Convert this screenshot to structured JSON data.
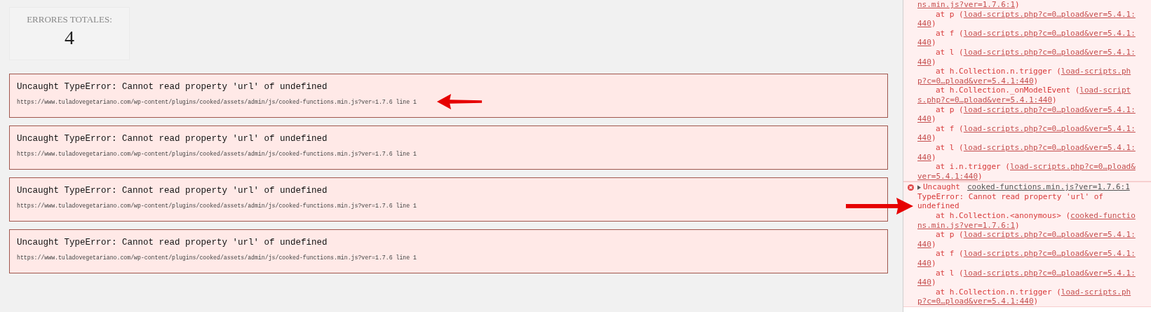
{
  "summary": {
    "label": "ERRORES TOTALES:",
    "count": "4"
  },
  "errors": [
    {
      "message": "Uncaught TypeError: Cannot read property 'url' of undefined",
      "source": "https://www.tuladovegetariano.com/wp-content/plugins/cooked/assets/admin/js/cooked-functions.min.js?ver=1.7.6 line 1",
      "highlighted": true
    },
    {
      "message": "Uncaught TypeError: Cannot read property 'url' of undefined",
      "source": "https://www.tuladovegetariano.com/wp-content/plugins/cooked/assets/admin/js/cooked-functions.min.js?ver=1.7.6 line 1",
      "highlighted": false
    },
    {
      "message": "Uncaught TypeError: Cannot read property 'url' of undefined",
      "source": "https://www.tuladovegetariano.com/wp-content/plugins/cooked/assets/admin/js/cooked-functions.min.js?ver=1.7.6 line 1",
      "highlighted": false
    },
    {
      "message": "Uncaught TypeError: Cannot read property 'url' of undefined",
      "source": "https://www.tuladovegetariano.com/wp-content/plugins/cooked/assets/admin/js/cooked-functions.min.js?ver=1.7.6 line 1",
      "highlighted": false
    }
  ],
  "console": {
    "messages": [
      {
        "header": false,
        "highlighted": false,
        "lines": [
          {
            "kind": "wrap",
            "parts": [
              {
                "text": "ns.min.js?ver=1.7.6:1",
                "link": true
              },
              {
                "text": ")",
                "link": false
              }
            ]
          },
          {
            "kind": "frame",
            "parts": [
              {
                "text": "at p (",
                "link": false
              },
              {
                "text": "load-scripts.php?c=0…pload&ver=5.4.1:",
                "link": true
              }
            ]
          },
          {
            "kind": "wrap",
            "parts": [
              {
                "text": "440",
                "link": true
              },
              {
                "text": ")",
                "link": false
              }
            ]
          },
          {
            "kind": "frame",
            "parts": [
              {
                "text": "at f (",
                "link": false
              },
              {
                "text": "load-scripts.php?c=0…pload&ver=5.4.1:",
                "link": true
              }
            ]
          },
          {
            "kind": "wrap",
            "parts": [
              {
                "text": "440",
                "link": true
              },
              {
                "text": ")",
                "link": false
              }
            ]
          },
          {
            "kind": "frame",
            "parts": [
              {
                "text": "at l (",
                "link": false
              },
              {
                "text": "load-scripts.php?c=0…pload&ver=5.4.1:",
                "link": true
              }
            ]
          },
          {
            "kind": "wrap",
            "parts": [
              {
                "text": "440",
                "link": true
              },
              {
                "text": ")",
                "link": false
              }
            ]
          },
          {
            "kind": "frame",
            "parts": [
              {
                "text": "at h.Collection.n.trigger (",
                "link": false
              },
              {
                "text": "load-scripts.ph",
                "link": true
              }
            ]
          },
          {
            "kind": "wrap",
            "parts": [
              {
                "text": "p?c=0…pload&ver=5.4.1:440",
                "link": true
              },
              {
                "text": ")",
                "link": false
              }
            ]
          },
          {
            "kind": "frame",
            "parts": [
              {
                "text": "at h.Collection._onModelEvent (",
                "link": false
              },
              {
                "text": "load-script",
                "link": true
              }
            ]
          },
          {
            "kind": "wrap",
            "parts": [
              {
                "text": "s.php?c=0…pload&ver=5.4.1:440",
                "link": true
              },
              {
                "text": ")",
                "link": false
              }
            ]
          },
          {
            "kind": "frame",
            "parts": [
              {
                "text": "at p (",
                "link": false
              },
              {
                "text": "load-scripts.php?c=0…pload&ver=5.4.1:",
                "link": true
              }
            ]
          },
          {
            "kind": "wrap",
            "parts": [
              {
                "text": "440",
                "link": true
              },
              {
                "text": ")",
                "link": false
              }
            ]
          },
          {
            "kind": "frame",
            "parts": [
              {
                "text": "at f (",
                "link": false
              },
              {
                "text": "load-scripts.php?c=0…pload&ver=5.4.1:",
                "link": true
              }
            ]
          },
          {
            "kind": "wrap",
            "parts": [
              {
                "text": "440",
                "link": true
              },
              {
                "text": ")",
                "link": false
              }
            ]
          },
          {
            "kind": "frame",
            "parts": [
              {
                "text": "at l (",
                "link": false
              },
              {
                "text": "load-scripts.php?c=0…pload&ver=5.4.1:",
                "link": true
              }
            ]
          },
          {
            "kind": "wrap",
            "parts": [
              {
                "text": "440",
                "link": true
              },
              {
                "text": ")",
                "link": false
              }
            ]
          },
          {
            "kind": "frame",
            "parts": [
              {
                "text": "at i.n.trigger (",
                "link": false
              },
              {
                "text": "load-scripts.php?c=0…pload&",
                "link": true
              }
            ]
          },
          {
            "kind": "wrap",
            "parts": [
              {
                "text": "ver=5.4.1:440",
                "link": true
              },
              {
                "text": ")",
                "link": false
              }
            ]
          }
        ]
      },
      {
        "header": true,
        "highlighted": true,
        "title": "Uncaught",
        "source": "cooked-functions.min.js?ver=1.7.6:1",
        "lines": [
          {
            "kind": "wrap",
            "parts": [
              {
                "text": "TypeError: Cannot read property 'url' of",
                "link": false
              }
            ]
          },
          {
            "kind": "wrap",
            "parts": [
              {
                "text": "undefined",
                "link": false
              }
            ]
          },
          {
            "kind": "frame",
            "parts": [
              {
                "text": "at h.Collection.<anonymous> (",
                "link": false
              },
              {
                "text": "cooked-functio",
                "link": true
              }
            ]
          },
          {
            "kind": "wrap",
            "parts": [
              {
                "text": "ns.min.js?ver=1.7.6:1",
                "link": true
              },
              {
                "text": ")",
                "link": false
              }
            ]
          },
          {
            "kind": "frame",
            "parts": [
              {
                "text": "at p (",
                "link": false
              },
              {
                "text": "load-scripts.php?c=0…pload&ver=5.4.1:",
                "link": true
              }
            ]
          },
          {
            "kind": "wrap",
            "parts": [
              {
                "text": "440",
                "link": true
              },
              {
                "text": ")",
                "link": false
              }
            ]
          },
          {
            "kind": "frame",
            "parts": [
              {
                "text": "at f (",
                "link": false
              },
              {
                "text": "load-scripts.php?c=0…pload&ver=5.4.1:",
                "link": true
              }
            ]
          },
          {
            "kind": "wrap",
            "parts": [
              {
                "text": "440",
                "link": true
              },
              {
                "text": ")",
                "link": false
              }
            ]
          },
          {
            "kind": "frame",
            "parts": [
              {
                "text": "at l (",
                "link": false
              },
              {
                "text": "load-scripts.php?c=0…pload&ver=5.4.1:",
                "link": true
              }
            ]
          },
          {
            "kind": "wrap",
            "parts": [
              {
                "text": "440",
                "link": true
              },
              {
                "text": ")",
                "link": false
              }
            ]
          },
          {
            "kind": "frame",
            "parts": [
              {
                "text": "at h.Collection.n.trigger (",
                "link": false
              },
              {
                "text": "load-scripts.ph",
                "link": true
              }
            ]
          },
          {
            "kind": "wrap",
            "parts": [
              {
                "text": "p?c=0…pload&ver=5.4.1:440",
                "link": true
              },
              {
                "text": ")",
                "link": false
              }
            ]
          }
        ]
      }
    ]
  }
}
